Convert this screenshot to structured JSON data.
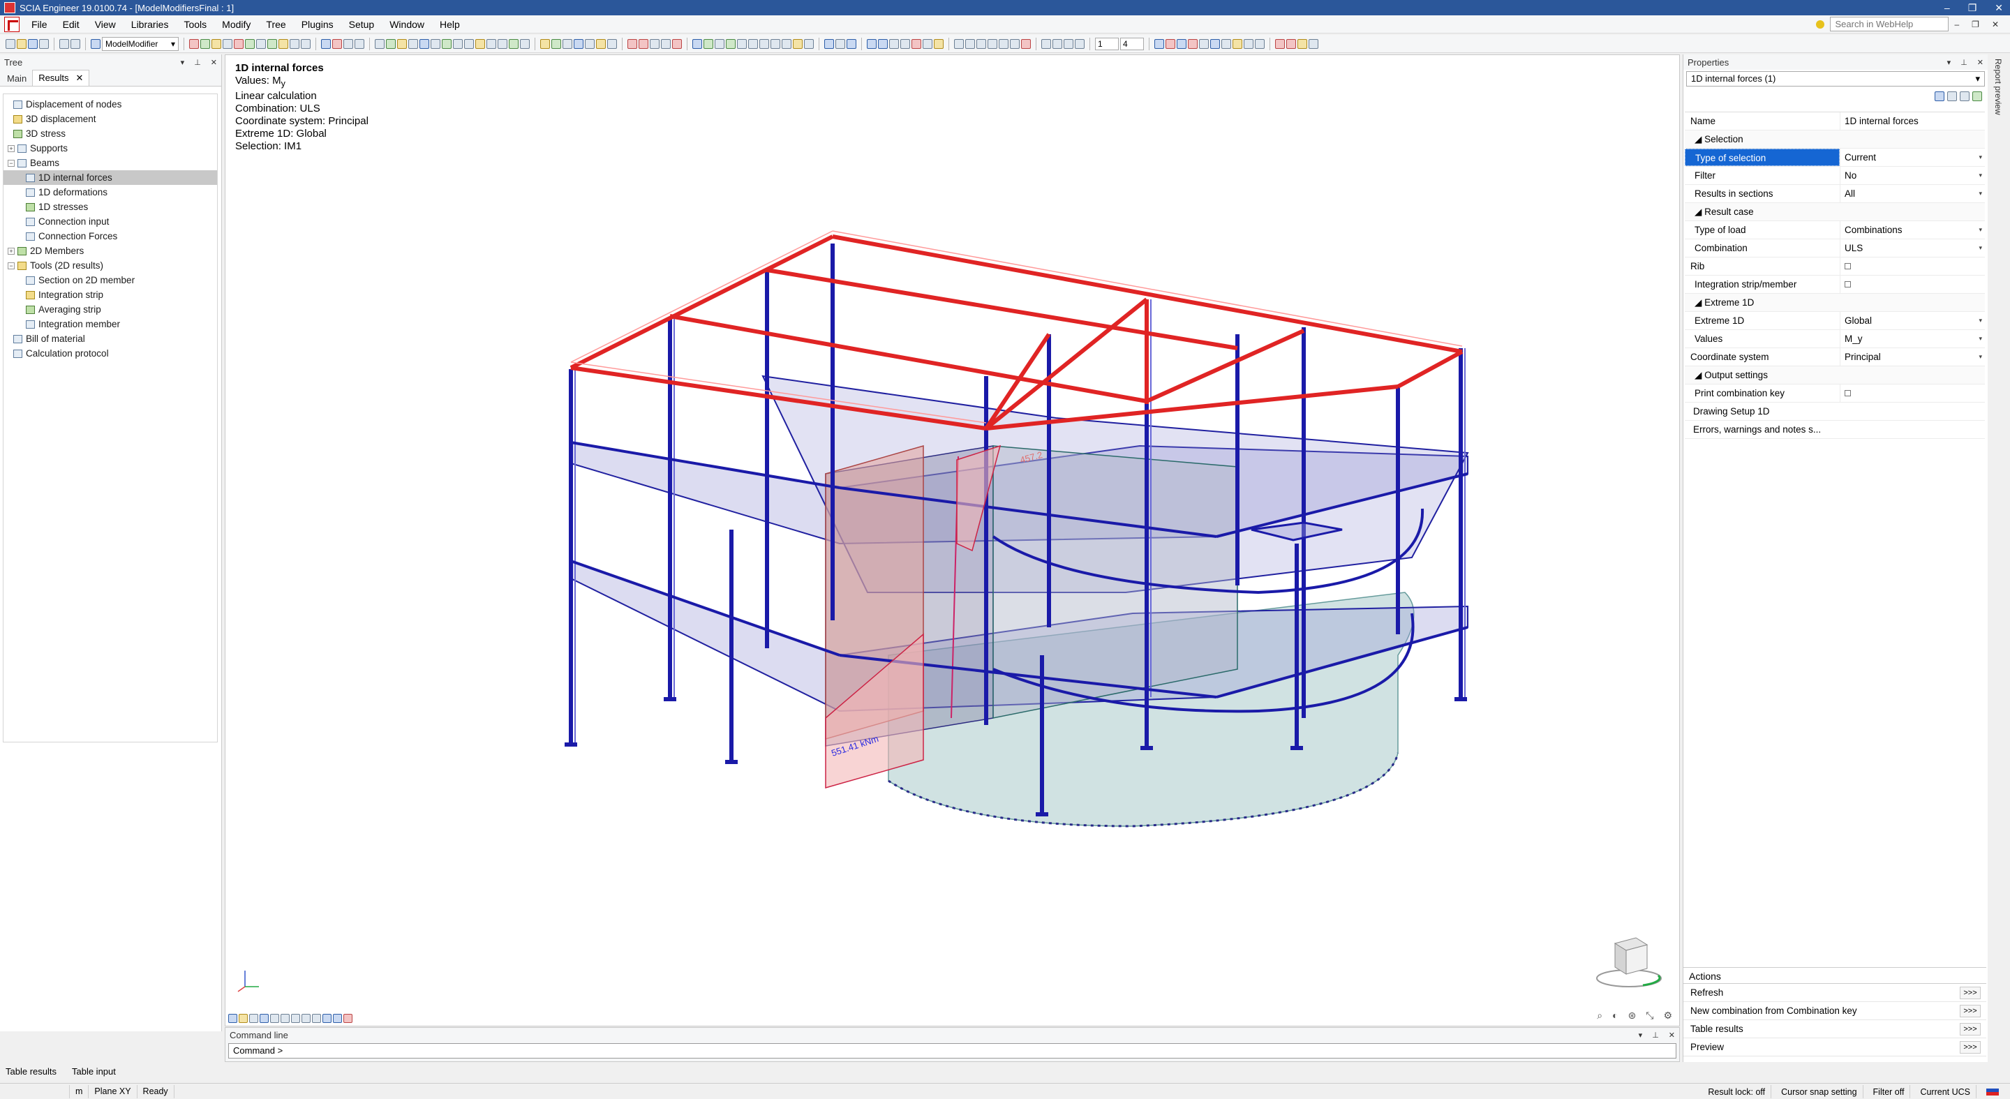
{
  "window": {
    "title": "SCIA Engineer 19.0100.74 - [ModelModifiersFinal : 1]",
    "min": "–",
    "restore": "❐",
    "close": "✕"
  },
  "menu": {
    "items": [
      "File",
      "Edit",
      "View",
      "Libraries",
      "Tools",
      "Modify",
      "Tree",
      "Plugins",
      "Setup",
      "Window",
      "Help"
    ],
    "search_placeholder": "Search in WebHelp"
  },
  "toolbar": {
    "view_combo": "ModelModifier",
    "spin1": "1",
    "spin2": "4"
  },
  "tree_panel": {
    "title": "Tree",
    "tabs": [
      "Main",
      "Results"
    ],
    "nodes": [
      "Displacement of nodes",
      "3D displacement",
      "3D stress",
      "Supports",
      "Beams",
      "1D internal forces",
      "1D deformations",
      "1D stresses",
      "Connection input",
      "Connection Forces",
      "2D Members",
      "Tools (2D results)",
      "Section on 2D member",
      "Integration strip",
      "Averaging strip",
      "Integration member",
      "Bill of material",
      "Calculation protocol"
    ]
  },
  "viewport": {
    "info": {
      "heading": "1D internal forces",
      "values": "Values: M",
      "values_sub": "y",
      "calc": "Linear calculation",
      "combination": "Combination: ULS",
      "coord": "Coordinate system: Principal",
      "extreme": "Extreme 1D: Global",
      "selection": "Selection: IM1"
    },
    "label_low": "551.41 kNm",
    "label_high": "457.2"
  },
  "command": {
    "title": "Command line",
    "prompt": "Command >"
  },
  "properties": {
    "title": "Properties",
    "object": "1D internal forces (1)",
    "name_key": "Name",
    "name_val": "1D internal forces",
    "sec_selection": "Selection",
    "type_sel_key": "Type of selection",
    "type_sel_val": "Current",
    "filter_key": "Filter",
    "filter_val": "No",
    "results_sections_key": "Results in sections",
    "results_sections_val": "All",
    "sec_result_case": "Result case",
    "type_load_key": "Type of load",
    "type_load_val": "Combinations",
    "combination_key": "Combination",
    "combination_val": "ULS",
    "rib_key": "Rib",
    "int_strip_key": "Integration strip/member",
    "sec_extreme": "Extreme 1D",
    "extreme_key": "Extreme 1D",
    "extreme_val": "Global",
    "values_key": "Values",
    "values_val": "M_y",
    "coord_key": "Coordinate system",
    "coord_val": "Principal",
    "sec_output": "Output settings",
    "print_key": "Print combination key",
    "drawing_setup": "Drawing Setup 1D",
    "errors": "Errors, warnings and notes s...",
    "actions_title": "Actions",
    "actions": [
      "Refresh",
      "New combination from Combination key",
      "Table results",
      "Preview"
    ],
    "go": ">>>"
  },
  "report_preview": "Report preview",
  "bottom_tabs": [
    "Table results",
    "Table input"
  ],
  "status": {
    "unit": "m",
    "plane": "Plane XY",
    "ready": "Ready",
    "result_lock": "Result lock: off",
    "cursor_snap": "Cursor snap setting",
    "filter": "Filter off",
    "ucs": "Current UCS"
  },
  "colors": {
    "accent": "#2b579a",
    "selection": "#1566d3",
    "beam_red": "#e02424",
    "beam_blue": "#1a1aa8",
    "slab": "#9a9ad8"
  }
}
